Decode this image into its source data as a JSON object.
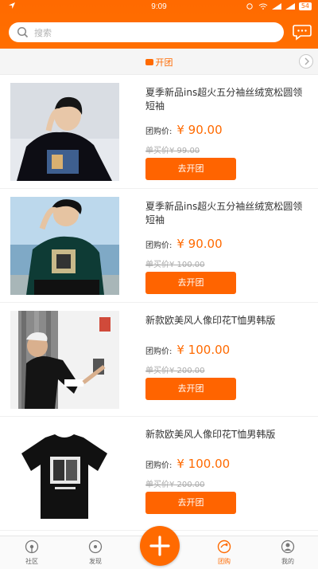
{
  "status_bar": {
    "time": "9:09",
    "battery": "54"
  },
  "search": {
    "placeholder": "搜索"
  },
  "group_bar": {
    "label": "开团"
  },
  "products": [
    {
      "title": "夏季新品ins超火五分袖丝绒宽松圆领短袖",
      "price_label": "团购价:",
      "price": "¥ 90.00",
      "original": "单买价¥ 99.00",
      "button": "去开团"
    },
    {
      "title": "夏季新品ins超火五分袖丝绒宽松圆领短袖",
      "price_label": "团购价:",
      "price": "¥ 90.00",
      "original": "单买价¥ 100.00",
      "button": "去开团"
    },
    {
      "title": "新款欧美风人像印花T恤男韩版",
      "price_label": "团购价:",
      "price": "¥ 100.00",
      "original": "单买价¥ 200.00",
      "button": "去开团"
    },
    {
      "title": "新款欧美风人像印花T恤男韩版",
      "price_label": "团购价:",
      "price": "¥ 100.00",
      "original": "单买价¥ 200.00",
      "button": "去开团"
    }
  ],
  "nav": {
    "community": "社区",
    "discover": "发现",
    "group": "团购",
    "mine": "我的"
  },
  "colors": {
    "accent": "#ff6a00",
    "button": "#ff6400"
  }
}
